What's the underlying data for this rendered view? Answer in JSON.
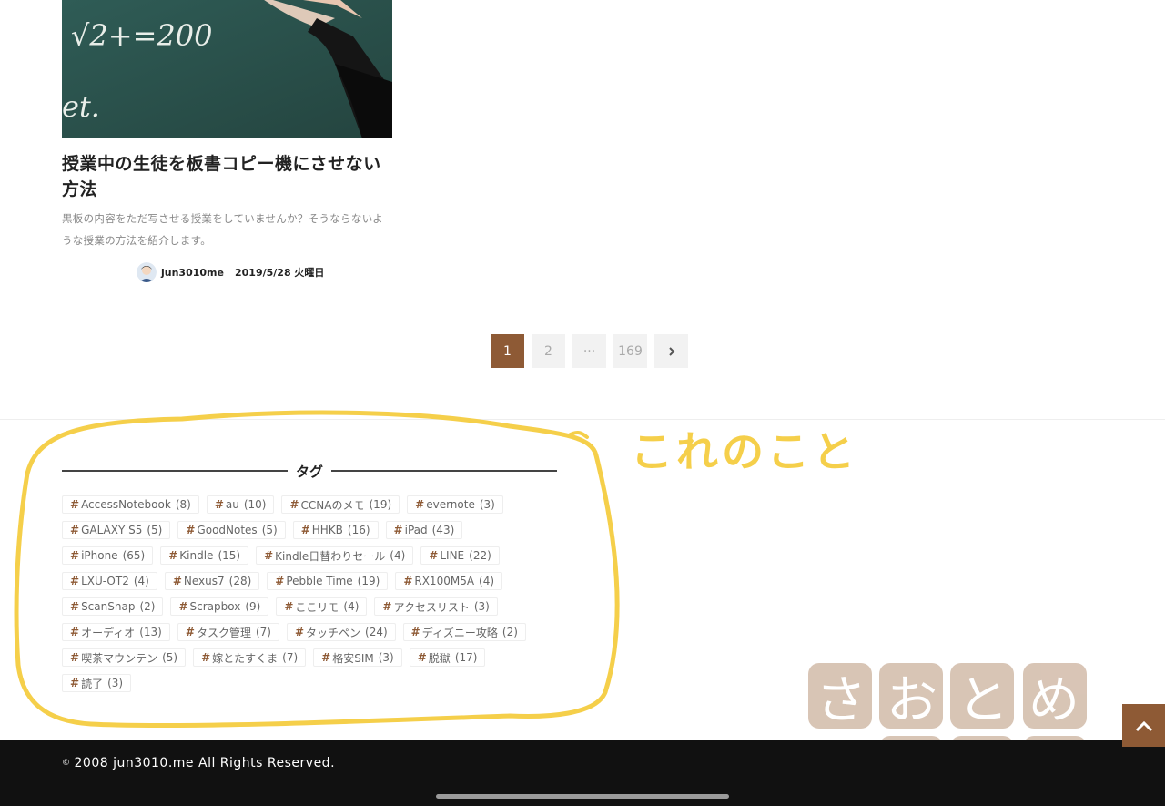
{
  "article": {
    "title": "授業中の生徒を板書コピー機にさせない方法",
    "excerpt": "黒板の内容をただ写させる授業をしていませんか？そうならないような授業の方法を紹介します。",
    "author": "jun3010me",
    "date": "2019/5/28 火曜日",
    "thumbnail_chalk_text": "√2+=200",
    "thumbnail_chalk_text_2": "et."
  },
  "pagination": {
    "current": "1",
    "pages": [
      "1",
      "2",
      "···",
      "169"
    ],
    "next_icon": "chevron-right-icon"
  },
  "tag_widget": {
    "title": "タグ",
    "tags": [
      {
        "name": "AccessNotebook",
        "count": "(8)"
      },
      {
        "name": "au",
        "count": "(10)"
      },
      {
        "name": "CCNAのメモ",
        "count": "(19)"
      },
      {
        "name": "evernote",
        "count": "(3)"
      },
      {
        "name": "GALAXY S5",
        "count": "(5)"
      },
      {
        "name": "GoodNotes",
        "count": "(5)"
      },
      {
        "name": "HHKB",
        "count": "(16)"
      },
      {
        "name": "iPad",
        "count": "(43)"
      },
      {
        "name": "iPhone",
        "count": "(65)"
      },
      {
        "name": "Kindle",
        "count": "(15)"
      },
      {
        "name": "Kindle日替わりセール",
        "count": "(4)"
      },
      {
        "name": "LINE",
        "count": "(22)"
      },
      {
        "name": "LXU-OT2",
        "count": "(4)"
      },
      {
        "name": "Nexus7",
        "count": "(28)"
      },
      {
        "name": "Pebble Time",
        "count": "(19)"
      },
      {
        "name": "RX100M5A",
        "count": "(4)"
      },
      {
        "name": "ScanSnap",
        "count": "(2)"
      },
      {
        "name": "Scrapbox",
        "count": "(9)"
      },
      {
        "name": "ここリモ",
        "count": "(4)"
      },
      {
        "name": "アクセスリスト",
        "count": "(3)"
      },
      {
        "name": "オーディオ",
        "count": "(13)"
      },
      {
        "name": "タスク管理",
        "count": "(7)"
      },
      {
        "name": "タッチペン",
        "count": "(24)"
      },
      {
        "name": "ディズニー攻略",
        "count": "(2)"
      },
      {
        "name": "喫茶マウンテン",
        "count": "(5)"
      },
      {
        "name": "嫁とたすくま",
        "count": "(7)"
      },
      {
        "name": "格安SIM",
        "count": "(3)"
      },
      {
        "name": "脱獄",
        "count": "(17)"
      },
      {
        "name": "読了",
        "count": "(3)"
      }
    ]
  },
  "annotation": {
    "note": "これのこと",
    "color": "#f5cf4a"
  },
  "logo": {
    "text": "さおとめらいふ"
  },
  "footer": {
    "copyright": "2008 jun3010.me All Rights Reserved.",
    "copy_mark": "©"
  },
  "colors": {
    "accent": "#8e5a35",
    "footer_bg": "#111111",
    "chalkboard": "#2f5c56"
  },
  "back_to_top_icon": "chevron-up-icon"
}
